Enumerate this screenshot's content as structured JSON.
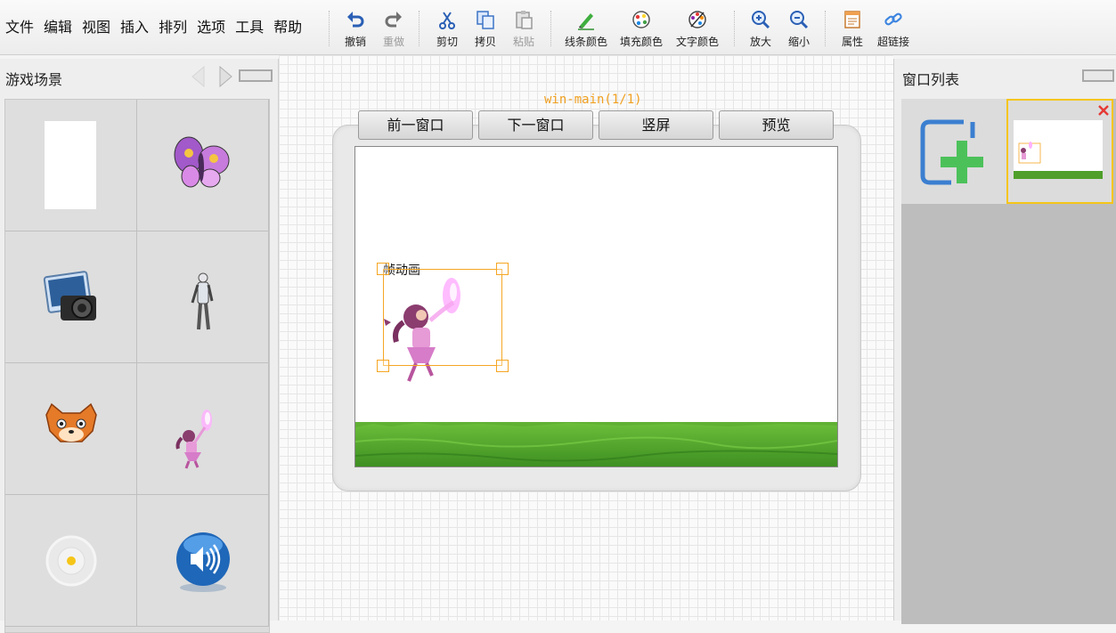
{
  "menu": [
    "文件",
    "编辑",
    "视图",
    "插入",
    "排列",
    "选项",
    "工具",
    "帮助"
  ],
  "toolbar": {
    "undo": "撤销",
    "redo": "重做",
    "cut": "剪切",
    "copy": "拷贝",
    "paste": "粘贴",
    "line_color": "线条颜色",
    "fill_color": "填充颜色",
    "text_color": "文字颜色",
    "zoom_in": "放大",
    "zoom_out": "缩小",
    "properties": "属性",
    "hyperlink": "超链接"
  },
  "left_panel": {
    "title": "游戏场景",
    "assets": [
      "white-rectangle",
      "butterfly",
      "camera",
      "robot-figure",
      "fox-face",
      "magic-girl-sprite",
      "sound-sensor-dot",
      "speaker-ball"
    ]
  },
  "canvas": {
    "window_title": "win-main(1/1)",
    "buttons": {
      "prev": "前一窗口",
      "next": "下一窗口",
      "portrait": "竖屏",
      "preview": "预览"
    },
    "frame_label": "帧动画"
  },
  "right_panel": {
    "title": "窗口列表"
  },
  "colors": {
    "selection": "#f5a623",
    "window_title": "#f0a020",
    "grass": "#4f9f2a",
    "thumb_border": "#f5c518",
    "add_blue": "#3b7fd0",
    "add_green": "#4cc15a"
  }
}
